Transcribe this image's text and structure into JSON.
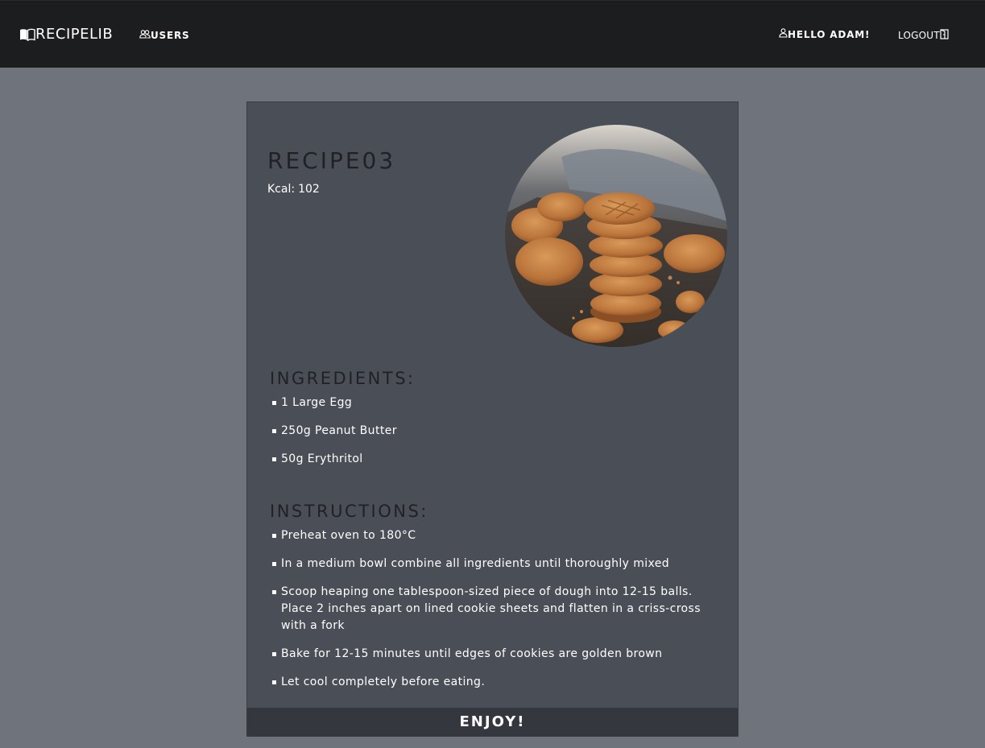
{
  "navbar": {
    "brand": "RECIPELIB",
    "users_label": "USERS",
    "greeting": "HELLO ADAM!",
    "logout_label": "LOGOUT"
  },
  "recipe": {
    "title": "RECIPE03",
    "kcal_label": "Kcal:",
    "kcal_value": "102",
    "ingredients_heading": "INGREDIENTS:",
    "ingredients": [
      "1 Large Egg",
      "250g Peanut Butter",
      "50g Erythritol"
    ],
    "instructions_heading": "INSTRUCTIONS:",
    "instructions": [
      "Preheat oven to 180°C",
      "In a medium bowl combine all ingredients until thoroughly mixed",
      "Scoop heaping one tablespoon-sized piece of dough into 12-15 balls. Place 2 inches apart on lined cookie sheets and flatten in a criss-cross with a fork",
      "Bake for 12-15 minutes until edges of cookies are golden brown",
      "Let cool completely before eating."
    ],
    "footer": "ENJOY!"
  }
}
